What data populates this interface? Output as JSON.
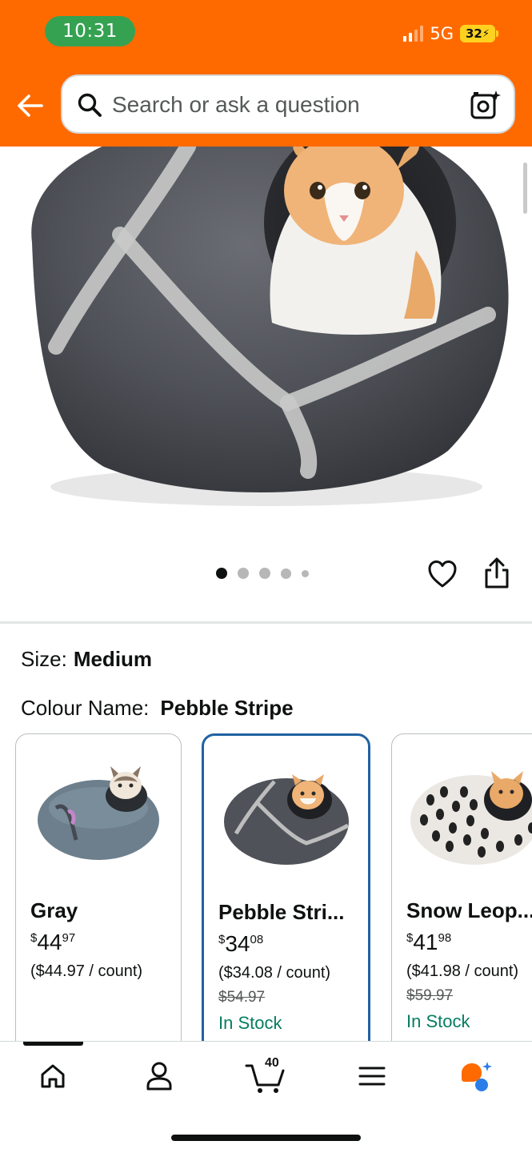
{
  "status_bar": {
    "time": "10:31",
    "network": "5G",
    "battery": "32"
  },
  "search": {
    "placeholder": "Search or ask a question"
  },
  "gallery": {
    "image_count": 5,
    "active_index": 0
  },
  "variations": {
    "size_label": "Size:",
    "size_value": "Medium",
    "colour_label": "Colour Name:",
    "colour_value": "Pebble Stripe"
  },
  "swatches": [
    {
      "name": "Gray",
      "currency": "$",
      "price_whole": "44",
      "price_fraction": "97",
      "unit_price": "($44.97 / count)",
      "was_price": "",
      "stock": "",
      "selected": false
    },
    {
      "name": "Pebble Stri...",
      "currency": "$",
      "price_whole": "34",
      "price_fraction": "08",
      "unit_price": "($34.08 / count)",
      "was_price": "$54.97",
      "stock": "In Stock",
      "selected": true
    },
    {
      "name": "Snow Leop...",
      "currency": "$",
      "price_whole": "41",
      "price_fraction": "98",
      "unit_price": "($41.98 / count)",
      "was_price": "$59.97",
      "stock": "In Stock",
      "selected": false
    }
  ],
  "bottom_nav": {
    "items": [
      "home-icon",
      "account-icon",
      "cart-icon",
      "menu-icon",
      "rufus-icon"
    ],
    "cart_count": "40"
  },
  "colors": {
    "header": "#ff6a00",
    "time_pill": "#35a252",
    "selected_border": "#2162a1",
    "in_stock": "#067d62",
    "battery": "#ffd21f"
  }
}
